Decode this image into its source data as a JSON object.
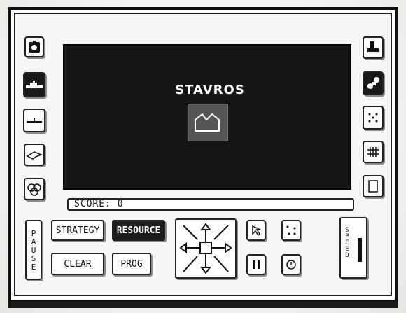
{
  "screen": {
    "title": "STAVROS",
    "score_label": "SCORE: 0"
  },
  "left_panel": {
    "icons": [
      "bomb-icon",
      "ship-icon",
      "submarine-icon",
      "aircraft-icon",
      "group-icon"
    ]
  },
  "right_panel": {
    "icons": [
      "boot-icon",
      "blocks-icon",
      "dice-icon",
      "grid-icon",
      "document-icon"
    ]
  },
  "controls": {
    "pause_label": "PAUSE",
    "strategy_label": "STRATEGY",
    "resource_label": "RESOURCE",
    "clear_label": "CLEAR",
    "prog_label": "PROG",
    "speed_label": "SPEED",
    "speed_level": 0.6
  },
  "colors": {
    "screen_bg": "#161616",
    "accent_dark": "#1d1d1d",
    "panel_bg": "#fbfbfb"
  }
}
